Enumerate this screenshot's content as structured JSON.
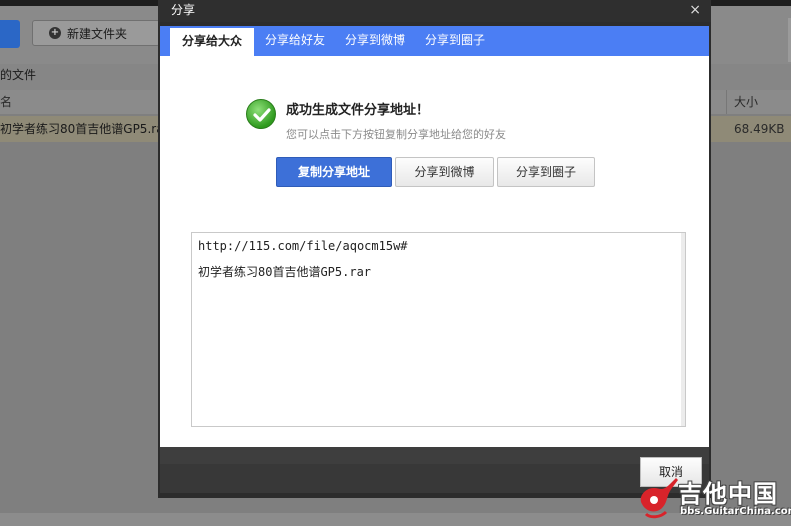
{
  "background": {
    "new_folder_label": "新建文件夹",
    "breadcrumb": "的文件",
    "columns": {
      "name": "名",
      "size": "大小"
    },
    "file_row": {
      "name": "初学者练习80首吉他谱GP5.rar",
      "size": "68.49KB"
    }
  },
  "dialog": {
    "title": "分享",
    "close_glyph": "×",
    "tabs": [
      {
        "label": "分享给大众"
      },
      {
        "label": "分享给好友"
      },
      {
        "label": "分享到微博"
      },
      {
        "label": "分享到圈子"
      }
    ],
    "success_title": "成功生成文件分享地址！",
    "success_subtitle": "您可以点击下方按钮复制分享地址给您的好友",
    "buttons": {
      "copy": "复制分享地址",
      "weibo": "分享到微博",
      "circle": "分享到圈子"
    },
    "share_box": {
      "url": "http://115.com/file/aqocm15w#",
      "filename": "初学者练习80首吉他谱GP5.rar"
    },
    "cancel_label": "取消"
  },
  "watermark": {
    "main": "吉他中国",
    "sub": "bbs.GuitarChina.com"
  },
  "colors": {
    "tab_bar": "#4b7ef4",
    "primary_button": "#3d70d8",
    "check_green": "#2f9a1e"
  }
}
